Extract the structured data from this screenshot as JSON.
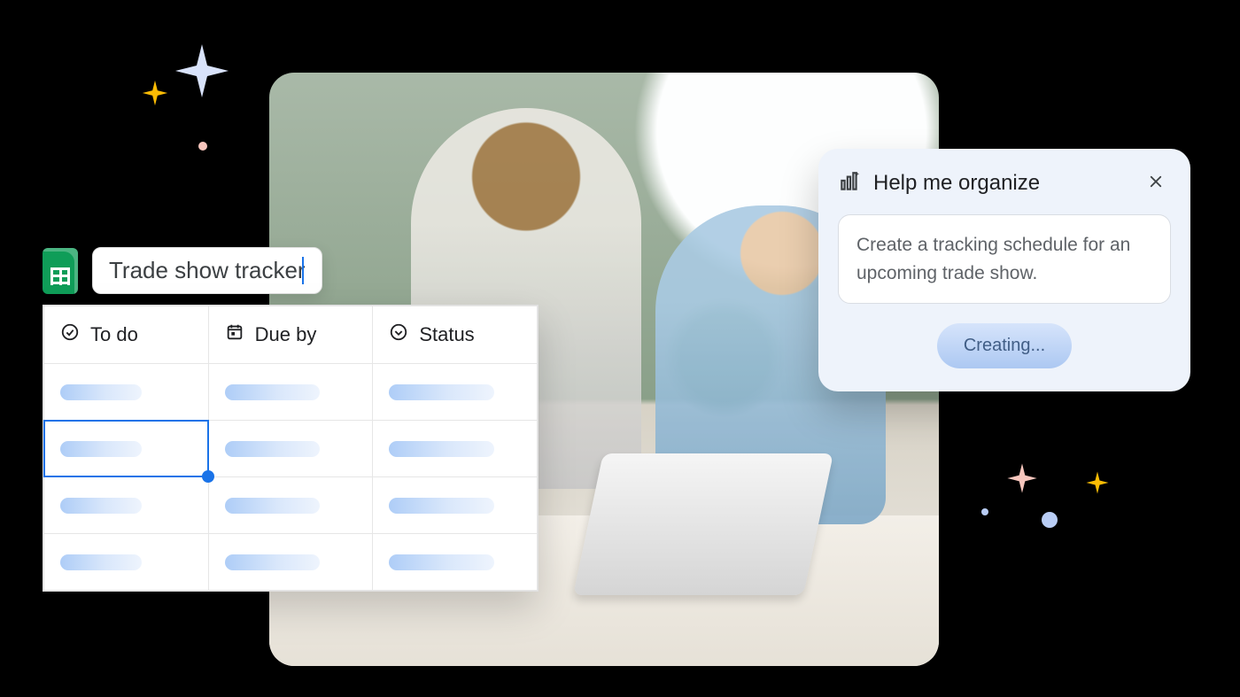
{
  "document": {
    "name": "Trade show tracker"
  },
  "columns": [
    {
      "icon": "check-circle-icon",
      "label": "To do"
    },
    {
      "icon": "calendar-icon",
      "label": "Due by"
    },
    {
      "icon": "dropdown-icon",
      "label": "Status"
    }
  ],
  "panel": {
    "title": "Help me organize",
    "prompt": "Create a tracking schedule for an upcoming trade show.",
    "action_label": "Creating..."
  }
}
